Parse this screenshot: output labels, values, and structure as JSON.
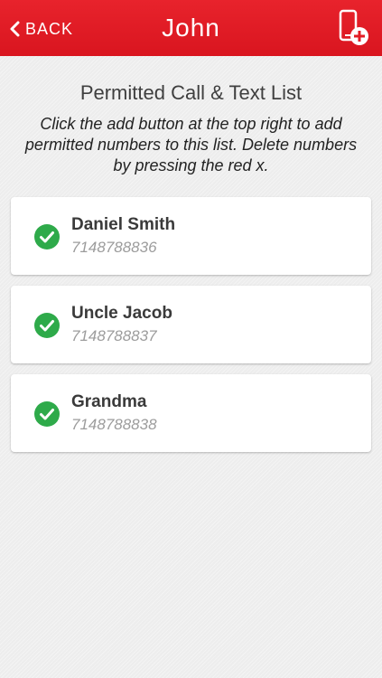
{
  "header": {
    "back_label": "BACK",
    "title": "John",
    "accent_color": "#e31d26"
  },
  "main": {
    "section_title": "Permitted Call & Text List",
    "instructions": "Click the add button at the top right to add permitted numbers to this list. Delete numbers by pressing the red x."
  },
  "contacts": [
    {
      "name": "Daniel Smith",
      "number": "7148788836",
      "status_icon": "check-circle-icon"
    },
    {
      "name": "Uncle Jacob",
      "number": "7148788837",
      "status_icon": "check-circle-icon"
    },
    {
      "name": "Grandma",
      "number": "7148788838",
      "status_icon": "check-circle-icon"
    }
  ],
  "icons": {
    "back": "chevron-left-icon",
    "add": "phone-add-icon",
    "check_color": "#2eaa4a"
  }
}
